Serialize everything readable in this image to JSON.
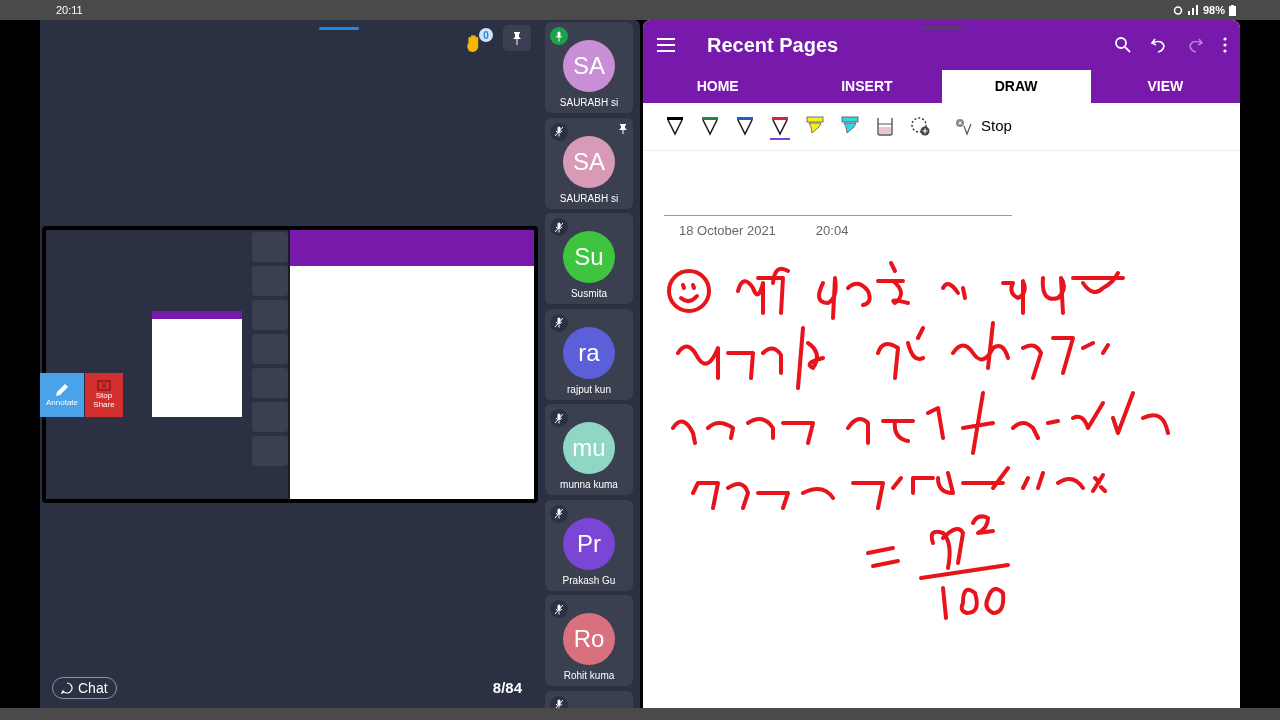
{
  "status_bar": {
    "time": "20:11",
    "battery": "98%"
  },
  "meeting": {
    "raised_hands": "0",
    "participants": [
      {
        "initials": "SA",
        "name": "SAURABH si",
        "color": "#c98fd6",
        "muted": false,
        "pinned": false
      },
      {
        "initials": "SA",
        "name": "SAURABH si",
        "color": "#d99ab8",
        "muted": true,
        "pinned": true
      },
      {
        "initials": "Su",
        "name": "Susmita",
        "color": "#3ec43e",
        "muted": true,
        "pinned": false
      },
      {
        "initials": "ra",
        "name": "rajput kun",
        "color": "#5b5fd8",
        "muted": true,
        "pinned": false
      },
      {
        "initials": "mu",
        "name": "munna kuma",
        "color": "#8fd6c4",
        "muted": true,
        "pinned": false
      },
      {
        "initials": "Pr",
        "name": "Prakash Gu",
        "color": "#7b45d6",
        "muted": true,
        "pinned": false
      },
      {
        "initials": "Ro",
        "name": "Rohit kuma",
        "color": "#d9707e",
        "muted": true,
        "pinned": false
      },
      {
        "muted": true,
        "pinned": false
      }
    ],
    "share_buttons": [
      {
        "kind": "annotate",
        "label": "Annotate"
      },
      {
        "kind": "stop",
        "label": "Stop Share"
      }
    ],
    "chat": "Chat",
    "page_counter": "8/84"
  },
  "notebook": {
    "title": "Recent Pages",
    "actions": [
      {
        "kind": "search",
        "disabled": false
      },
      {
        "kind": "undo",
        "disabled": false
      },
      {
        "kind": "redo",
        "disabled": true
      },
      {
        "kind": "more",
        "disabled": false
      }
    ],
    "tabs": [
      {
        "label": "HOME",
        "selected": false
      },
      {
        "label": "INSERT",
        "selected": false
      },
      {
        "label": "DRAW",
        "selected": true
      },
      {
        "label": "VIEW",
        "selected": false
      }
    ],
    "tools": [
      {
        "kind": "pen",
        "color": "#000000",
        "selected": false
      },
      {
        "kind": "pen",
        "color": "#1a8a3a",
        "selected": false
      },
      {
        "kind": "pen",
        "color": "#1f5fbf",
        "selected": false
      },
      {
        "kind": "pen",
        "color": "#e0202a",
        "selected": true
      },
      {
        "kind": "highlighter",
        "color": "#f2f21a",
        "selected": false
      },
      {
        "kind": "highlighter",
        "color": "#2fd8e8",
        "selected": false
      },
      {
        "kind": "eraser",
        "selected": false
      },
      {
        "kind": "lasso",
        "selected": false
      }
    ],
    "stop": "Stop",
    "date": "18 October 2021",
    "time": "20:04"
  }
}
